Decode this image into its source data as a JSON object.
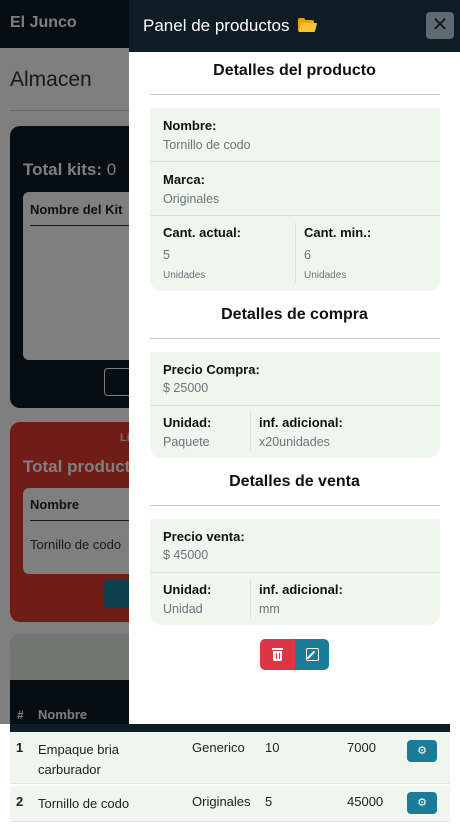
{
  "navbar": {
    "brand": "El Junco"
  },
  "page": {
    "title": "Almacen"
  },
  "kits_card": {
    "total_label": "Total kits:",
    "total_value": " 0",
    "column_header": "Nombre del Kit"
  },
  "low_stock_card": {
    "top_label": "Li",
    "total_label": "Total productos",
    "column_header": "Nombre",
    "rows": [
      "Tornillo de codo"
    ]
  },
  "products_table": {
    "headers": {
      "num": "#",
      "name": "Nombre"
    },
    "rows": [
      {
        "num": "1",
        "name": "Empaque bria carburador",
        "brand": "Generico",
        "qty": "10",
        "price": "7000",
        "action_icon": "gear-icon"
      },
      {
        "num": "2",
        "name": "Tornillo de codo",
        "brand": "Originales",
        "qty": "5",
        "price": "45000",
        "action_icon": "gear-icon"
      }
    ]
  },
  "panel": {
    "title": "Panel de productos",
    "title_icon": "folder-open-icon",
    "close_label": "✕",
    "product_details": {
      "heading": "Detalles del producto",
      "name_label": "Nombre:",
      "name_value": "Tornillo de codo",
      "brand_label": "Marca:",
      "brand_value": "Originales",
      "current_qty_label": "Cant. actual:",
      "current_qty_value": "5",
      "current_qty_unit": "Unidades",
      "min_qty_label": "Cant. min.:",
      "min_qty_value": "6",
      "min_qty_unit": "Unidades"
    },
    "purchase_details": {
      "heading": "Detalles de compra",
      "price_label": "Precio Compra:",
      "price_value": "$ 25000",
      "unit_label": "Unidad:",
      "unit_value": "Paquete",
      "info_label": "inf. adicional:",
      "info_value": "x20unidades"
    },
    "sale_details": {
      "heading": "Detalles de venta",
      "price_label": "Precio venta:",
      "price_value": "$ 45000",
      "unit_label": "Unidad:",
      "unit_value": "Unidad",
      "info_label": "inf. adicional:",
      "info_value": "mm"
    },
    "actions": {
      "delete_icon": "trash-icon",
      "edit_icon": "edit-icon"
    }
  },
  "colors": {
    "navbar": "#0e1c26",
    "accent": "#1a7c98",
    "danger": "#dc3545",
    "card_bg": "#eef6ee",
    "warning_card": "#e0392e"
  }
}
